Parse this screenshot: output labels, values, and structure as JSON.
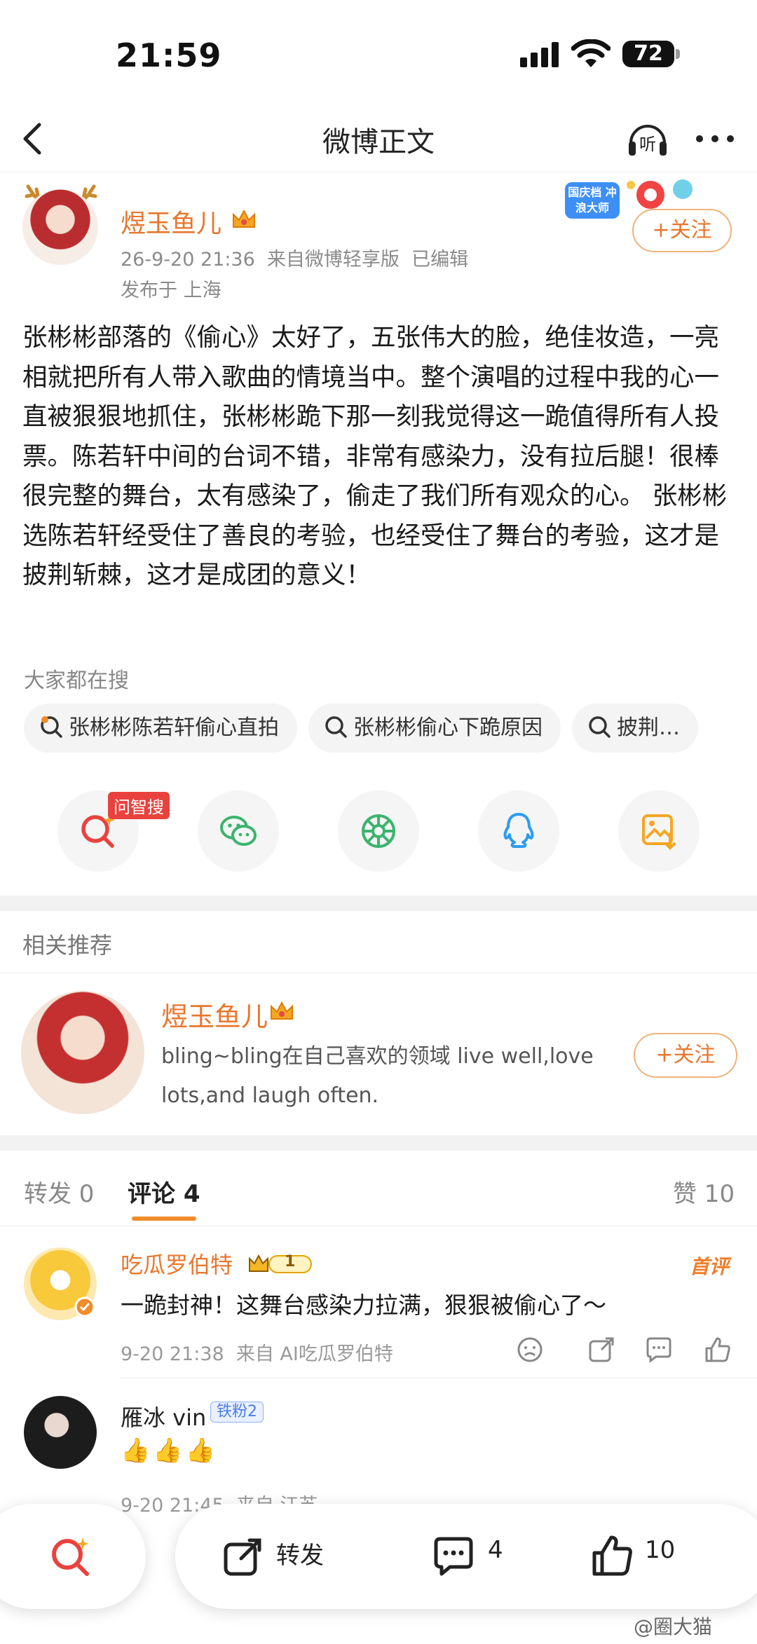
{
  "status_bar": {
    "time": "21:59",
    "battery": "72"
  },
  "nav": {
    "title": "微博正文",
    "listen_label": "听"
  },
  "post": {
    "author": "煜玉鱼儿",
    "meta": "26-9-20 21:36  来自微博轻享版  已编辑",
    "location": "发布于 上海",
    "follow_label": "+关注",
    "badge_text": "国庆档 冲浪大师",
    "text": "张彬彬部落的《偷心》太好了，五张伟大的脸，绝佳妆造，一亮相就把所有人带入歌曲的情境当中。整个演唱的过程中我的心一直被狠狠地抓住，张彬彬跪下那一刻我觉得这一跪值得所有人投票。陈若轩中间的台词不错，非常有感染力，没有拉后腿！很棒很完整的舞台，太有感染了，偷走了我们所有观众的心。 张彬彬选陈若轩经受住了善良的考验，也经受住了舞台的考验，这才是披荆斩棘，这才是成团的意义！"
  },
  "search": {
    "title": "大家都在搜",
    "chips": [
      "张彬彬陈若轩偷心直拍",
      "张彬彬偷心下跪原因",
      "披荆…"
    ]
  },
  "share": {
    "ai_tag": "问智搜",
    "icons": [
      "ai-search-icon",
      "wechat-icon",
      "moments-icon",
      "qq-icon",
      "save-image-icon"
    ]
  },
  "related": {
    "title": "相关推荐",
    "name": "煜玉鱼儿",
    "desc": "bling~bling在自己喜欢的领域 live well,love lots,and laugh often.",
    "follow_label": "+关注"
  },
  "tabs": {
    "repost": "转发 0",
    "comment": "评论 4",
    "like": "赞 10"
  },
  "comments": [
    {
      "name": "吃瓜罗伯特",
      "badge": "首评",
      "vip_level": "1",
      "text": "一跪封神！这舞台感染力拉满，狠狠被偷心了～",
      "meta": "9-20 21:38  来自 AI吃瓜罗伯特"
    },
    {
      "name": "雁冰 vin",
      "fan_badge": "铁粉2",
      "text": "👍👍👍",
      "meta": "9-20 21:45  来自 江苏"
    }
  ],
  "bottom_bar": {
    "repost_label": "转发",
    "comment_count": "4",
    "like_count": "10"
  },
  "watermark": "@圈大猫",
  "colors": {
    "accent": "#e8772e",
    "brand_red": "#e9423e"
  }
}
